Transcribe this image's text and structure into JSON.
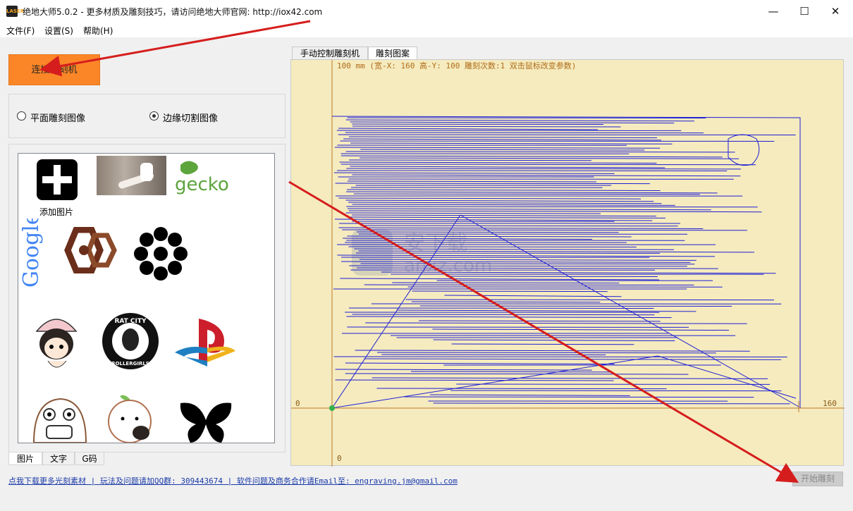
{
  "window": {
    "title": "绝地大师5.0.2 - 更多材质及雕刻技巧，请访问绝地大师官网: http://iox42.com",
    "icon_text": "LASER",
    "controls": {
      "minimize": "—",
      "maximize": "☐",
      "close": "✕"
    }
  },
  "menu": {
    "items": [
      "文件(F)",
      "设置(S)",
      "帮助(H)"
    ]
  },
  "left": {
    "connect_button": "连接雕刻机",
    "modes": [
      {
        "label": "平面雕刻图像",
        "selected": false
      },
      {
        "label": "边缘切割图像",
        "selected": true
      }
    ],
    "gallery": {
      "add_caption": "添加图片",
      "items": [
        "add-picture",
        "girl-photo",
        "gecko-logo",
        "google-logo",
        "hexagon-logo",
        "flower-icon",
        "cartoon-girl",
        "rat-city-rollergirls-logo",
        "playstation-logo",
        "monster-cartoon",
        "peach-cartoon",
        "butterfly-icon"
      ],
      "logo_texts": {
        "gecko": "gecko",
        "google": "Google",
        "rat_city_top": "RAT CITY",
        "rat_city_bottom": "ROLLERGIRLS"
      }
    },
    "bottom_tabs": [
      "图片",
      "文字",
      "G码"
    ],
    "active_bottom_tab": 0
  },
  "right": {
    "tabs": [
      "手动控制雕刻机",
      "雕刻图案"
    ],
    "active_tab": 1,
    "canvas": {
      "info": "100 mm  (宽-X: 160  高-Y: 100  雕刻次数:1  双击鼠标改变参数)",
      "width_x": 160,
      "height_y": 100,
      "passes": 1,
      "x_axis_start": "0",
      "x_axis_end": "160",
      "y_axis_start": "0",
      "colors": {
        "background": "#f5ebbe",
        "axis": "#c07a2a",
        "path": "#1f1fd6",
        "origin": "#34b24a"
      }
    },
    "start_button": "开始雕刻"
  },
  "footer": {
    "links_text": "点我下载更多光刻素材 | 玩法及问题请加QQ群: 309443674 | 软件问题及商务合作请Email至: engraving.jm@gmail.com"
  },
  "watermark": {
    "text": "anxz.com",
    "cn": "安下载"
  }
}
